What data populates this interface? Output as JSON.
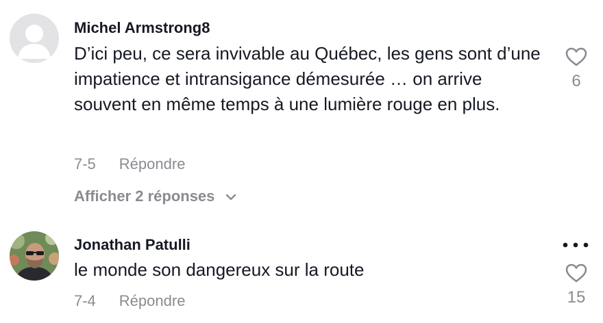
{
  "comments": [
    {
      "author": "Michel Armstrong8",
      "text": "D’ici peu, ce sera invivable au Québec, les gens sont d’une impatience et intransigance démesurée … on arrive souvent en même temps à une lumière rouge en plus.",
      "date": "7-5",
      "reply_label": "Répondre",
      "likes": "6",
      "view_replies_label": "Afficher 2 réponses",
      "avatar": "default-avatar-icon"
    },
    {
      "author": "Jonathan Patulli",
      "text": "le monde son dangereux sur la route",
      "date": "7-4",
      "reply_label": "Répondre",
      "likes": "15",
      "avatar": "user-photo"
    }
  ],
  "icons": {
    "like": "heart-outline-icon",
    "expand": "chevron-down-icon",
    "more": "more-dots-icon"
  },
  "colors": {
    "text_primary": "#161823",
    "text_secondary": "#8a8b91",
    "default_avatar_bg": "#e3e3e6"
  }
}
